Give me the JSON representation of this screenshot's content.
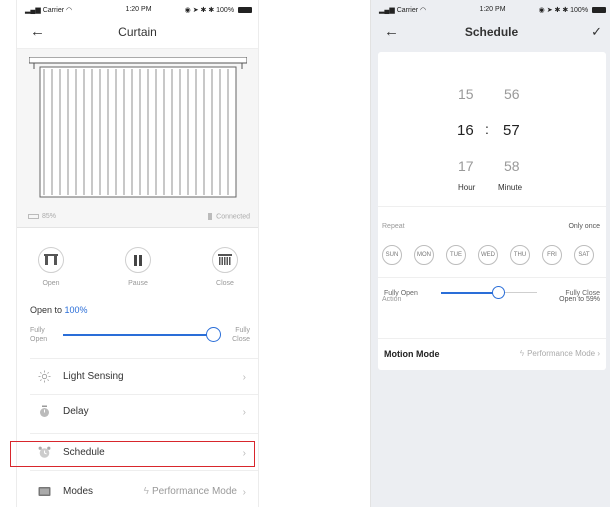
{
  "status_bar": {
    "carrier": "Carrier",
    "time": "1:20 PM",
    "battery": "100%"
  },
  "left_screen": {
    "title": "Curtain",
    "battery_level": "85%",
    "connection": "Connected",
    "controls": [
      {
        "label": "Open",
        "icon": "curtain-open-icon"
      },
      {
        "label": "Pause",
        "icon": "pause-icon"
      },
      {
        "label": "Close",
        "icon": "curtain-close-icon"
      }
    ],
    "open_to_prefix": "Open to ",
    "open_to_value": "100%",
    "slider": {
      "left_label_1": "Fully",
      "left_label_2": "Open",
      "right_label_1": "Fully",
      "right_label_2": "Close",
      "fraction": 1.0
    },
    "menu": [
      {
        "label": "Light Sensing",
        "icon": "sun-icon"
      },
      {
        "label": "Delay",
        "icon": "timer-icon"
      },
      {
        "label": "Schedule",
        "icon": "alarm-clock-icon"
      },
      {
        "label": "Modes",
        "icon": "modes-icon",
        "value": "Performance Mode"
      }
    ],
    "colors": {
      "accent": "#2a6ed8",
      "highlight": "#d8262c"
    }
  },
  "right_screen": {
    "title": "Schedule",
    "hours": [
      "15",
      "16",
      "17"
    ],
    "minutes": [
      "56",
      "57",
      "58"
    ],
    "colon": ":",
    "hour_label": "Hour",
    "minute_label": "Minute",
    "repeat_label": "Repeat",
    "repeat_value": "Only once",
    "days": [
      "SUN",
      "MON",
      "TUE",
      "WED",
      "THU",
      "FRI",
      "SAT"
    ],
    "action_label": "Action",
    "action_value": "Open to 59%",
    "slider": {
      "left_label": "Fully Open",
      "right_label": "Fully Close",
      "fraction": 0.59
    },
    "motion_label": "Motion Mode",
    "motion_value": "Performance Mode"
  }
}
